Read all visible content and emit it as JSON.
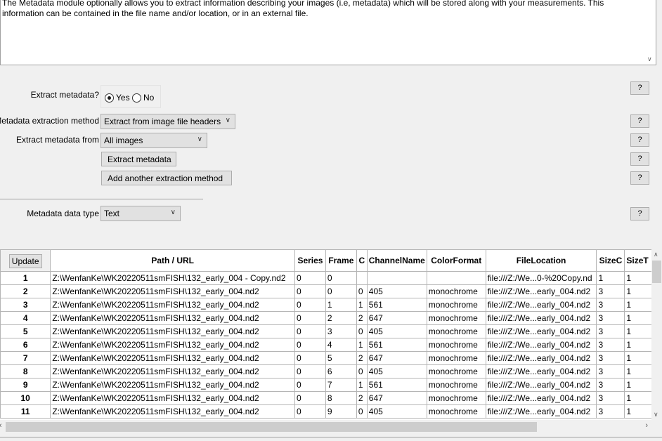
{
  "description": {
    "line1": "The Metadata module optionally allows you to extract information describing your images (i.e, metadata) which will be stored along with your measurements. This",
    "line2": "information can be contained in the file name and/or location, or in an external file."
  },
  "settings": {
    "extract_label": "Extract metadata?",
    "yes_label": "Yes",
    "no_label": "No",
    "extract_selected": "Yes",
    "method_label": "Metadata extraction method",
    "method_value": "Extract from image file headers",
    "from_label": "Extract metadata from",
    "from_value": "All images",
    "extract_button": "Extract metadata",
    "add_method_button": "Add another extraction method",
    "datatype_label": "Metadata data type",
    "datatype_value": "Text",
    "help_label": "?"
  },
  "table": {
    "update_label": "Update",
    "columns": [
      "Path / URL",
      "Series",
      "Frame",
      "C",
      "ChannelName",
      "ColorFormat",
      "FileLocation",
      "SizeC",
      "SizeT"
    ],
    "rows": [
      {
        "n": "1",
        "path": "Z:\\WenfanKe\\WK20220511smFISH\\132_early_004 - Copy.nd2",
        "series": "0",
        "frame": "0",
        "c": "",
        "channel": "",
        "color": "",
        "loc": "file:///Z:/We...0-%20Copy.nd",
        "sizec": "1",
        "sizet": "1"
      },
      {
        "n": "2",
        "path": "Z:\\WenfanKe\\WK20220511smFISH\\132_early_004.nd2",
        "series": "0",
        "frame": "0",
        "c": "0",
        "channel": "405",
        "color": "monochrome",
        "loc": "file:///Z:/We...early_004.nd2",
        "sizec": "3",
        "sizet": "1"
      },
      {
        "n": "3",
        "path": "Z:\\WenfanKe\\WK20220511smFISH\\132_early_004.nd2",
        "series": "0",
        "frame": "1",
        "c": "1",
        "channel": "561",
        "color": "monochrome",
        "loc": "file:///Z:/We...early_004.nd2",
        "sizec": "3",
        "sizet": "1"
      },
      {
        "n": "4",
        "path": "Z:\\WenfanKe\\WK20220511smFISH\\132_early_004.nd2",
        "series": "0",
        "frame": "2",
        "c": "2",
        "channel": "647",
        "color": "monochrome",
        "loc": "file:///Z:/We...early_004.nd2",
        "sizec": "3",
        "sizet": "1"
      },
      {
        "n": "5",
        "path": "Z:\\WenfanKe\\WK20220511smFISH\\132_early_004.nd2",
        "series": "0",
        "frame": "3",
        "c": "0",
        "channel": "405",
        "color": "monochrome",
        "loc": "file:///Z:/We...early_004.nd2",
        "sizec": "3",
        "sizet": "1"
      },
      {
        "n": "6",
        "path": "Z:\\WenfanKe\\WK20220511smFISH\\132_early_004.nd2",
        "series": "0",
        "frame": "4",
        "c": "1",
        "channel": "561",
        "color": "monochrome",
        "loc": "file:///Z:/We...early_004.nd2",
        "sizec": "3",
        "sizet": "1"
      },
      {
        "n": "7",
        "path": "Z:\\WenfanKe\\WK20220511smFISH\\132_early_004.nd2",
        "series": "0",
        "frame": "5",
        "c": "2",
        "channel": "647",
        "color": "monochrome",
        "loc": "file:///Z:/We...early_004.nd2",
        "sizec": "3",
        "sizet": "1"
      },
      {
        "n": "8",
        "path": "Z:\\WenfanKe\\WK20220511smFISH\\132_early_004.nd2",
        "series": "0",
        "frame": "6",
        "c": "0",
        "channel": "405",
        "color": "monochrome",
        "loc": "file:///Z:/We...early_004.nd2",
        "sizec": "3",
        "sizet": "1"
      },
      {
        "n": "9",
        "path": "Z:\\WenfanKe\\WK20220511smFISH\\132_early_004.nd2",
        "series": "0",
        "frame": "7",
        "c": "1",
        "channel": "561",
        "color": "monochrome",
        "loc": "file:///Z:/We...early_004.nd2",
        "sizec": "3",
        "sizet": "1"
      },
      {
        "n": "10",
        "path": "Z:\\WenfanKe\\WK20220511smFISH\\132_early_004.nd2",
        "series": "0",
        "frame": "8",
        "c": "2",
        "channel": "647",
        "color": "monochrome",
        "loc": "file:///Z:/We...early_004.nd2",
        "sizec": "3",
        "sizet": "1"
      },
      {
        "n": "11",
        "path": "Z:\\WenfanKe\\WK20220511smFISH\\132_early_004.nd2",
        "series": "0",
        "frame": "9",
        "c": "0",
        "channel": "405",
        "color": "monochrome",
        "loc": "file:///Z:/We...early_004.nd2",
        "sizec": "3",
        "sizet": "1"
      }
    ]
  }
}
